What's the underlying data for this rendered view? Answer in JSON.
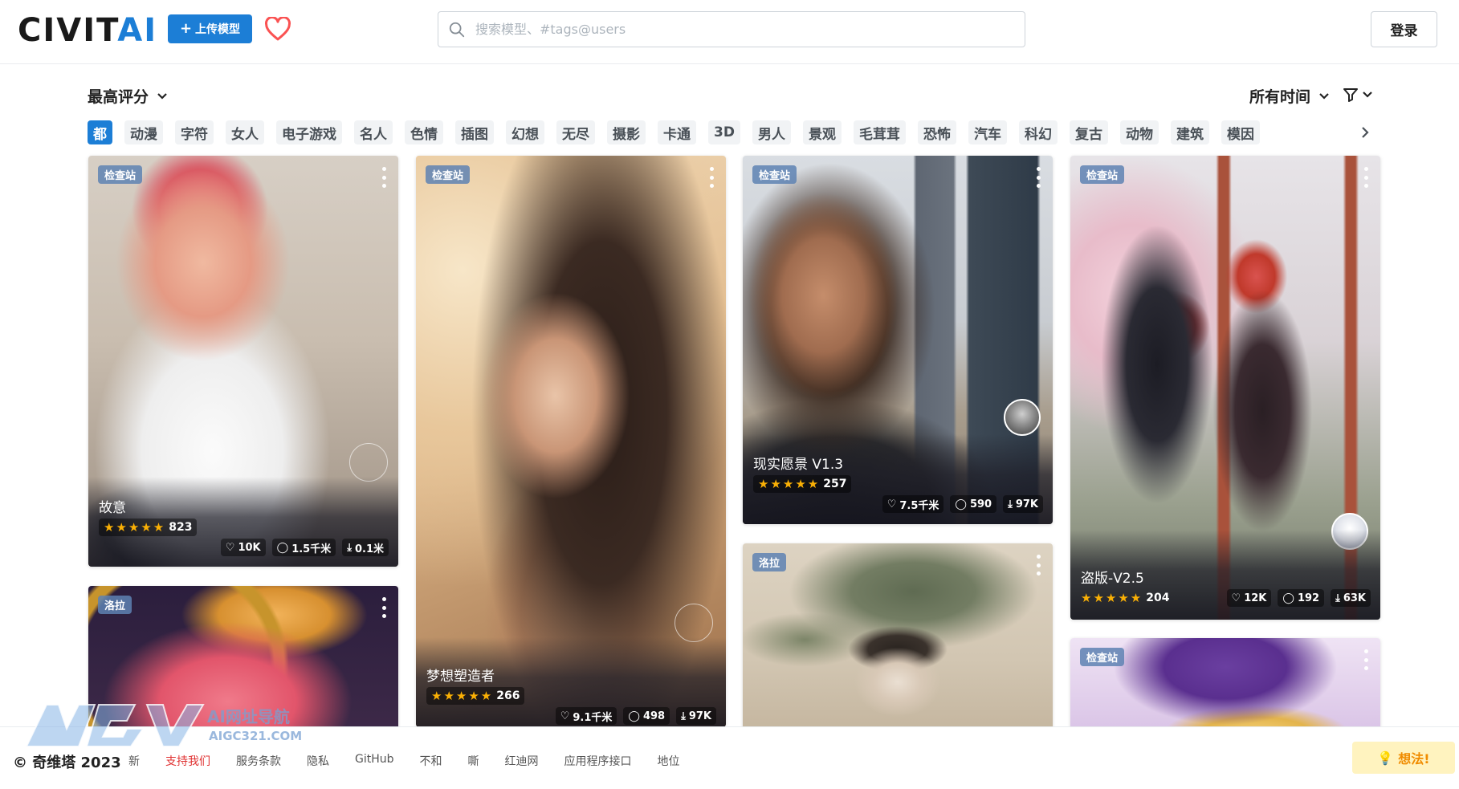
{
  "header": {
    "logo_main": "CIVIT",
    "logo_accent": "AI",
    "upload_label": "上传模型",
    "search_placeholder": "搜索模型、#tags@users",
    "login_label": "登录"
  },
  "toolbar": {
    "sort_label": "最高评分",
    "period_label": "所有时间"
  },
  "categories": [
    "都",
    "动漫",
    "字符",
    "女人",
    "电子游戏",
    "名人",
    "色情",
    "插图",
    "幻想",
    "无尽",
    "摄影",
    "卡通",
    "3D",
    "男人",
    "景观",
    "毛茸茸",
    "恐怖",
    "汽车",
    "科幻",
    "复古",
    "动物",
    "建筑",
    "模因"
  ],
  "cards": [
    {
      "badge": "检查站",
      "title": "故意",
      "rating": "823",
      "likes": "10K",
      "comments": "1.5千米",
      "downloads": "0.1米"
    },
    {
      "badge": "检查站",
      "title": "梦想塑造者",
      "rating": "266",
      "likes": "9.1千米",
      "comments": "498",
      "downloads": "97K"
    },
    {
      "badge": "检查站",
      "title": "现实愿景 V1.3",
      "rating": "257",
      "likes": "7.5千米",
      "comments": "590",
      "downloads": "97K"
    },
    {
      "badge": "检查站",
      "title": "盗版-V2.5",
      "rating": "204",
      "likes": "12K",
      "comments": "192",
      "downloads": "63K"
    },
    {
      "badge": "洛拉"
    },
    {
      "badge": "洛拉"
    },
    {
      "badge": "检查站"
    }
  ],
  "footer": {
    "copyright": "© 奇维塔 2023",
    "links": [
      "新",
      "支持我们",
      "服务条款",
      "隐私",
      "GitHub",
      "不和",
      "嘶",
      "红迪网",
      "应用程序接口",
      "地位"
    ],
    "idea_label": "想法!"
  },
  "watermark": {
    "text": "AI网址导航",
    "domain": "AIGC321.COM"
  },
  "colors": {
    "brand_blue": "#1c7ed6",
    "star": "#fab005",
    "heart": "#fa5252",
    "idea_bg": "#fff3bf"
  }
}
